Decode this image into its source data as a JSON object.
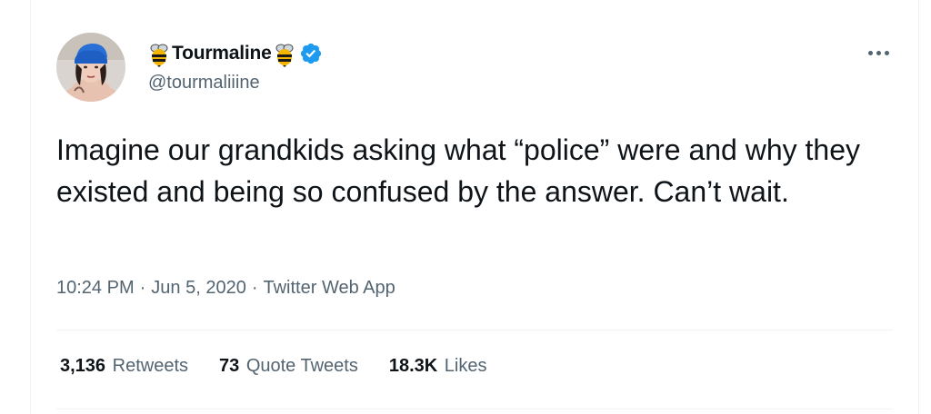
{
  "tweet": {
    "author": {
      "display_name": "Tourmaline",
      "handle": "@tourmaliiine",
      "verified": true,
      "name_emoji": "bee-icon"
    },
    "text": "Imagine our grandkids asking what “police” were and why they existed and being so confused by the answer. Can’t wait.",
    "timestamp": {
      "time": "10:24 PM",
      "date": "Jun 5, 2020",
      "source": "Twitter Web App",
      "separator": "·"
    },
    "stats": [
      {
        "count": "3,136",
        "label": "Retweets"
      },
      {
        "count": "73",
        "label": "Quote Tweets"
      },
      {
        "count": "18.3K",
        "label": "Likes"
      }
    ]
  },
  "colors": {
    "text_primary": "#0f1419",
    "text_secondary": "#536471",
    "verified_blue": "#1d9bf0",
    "divider": "#eff3f4"
  }
}
